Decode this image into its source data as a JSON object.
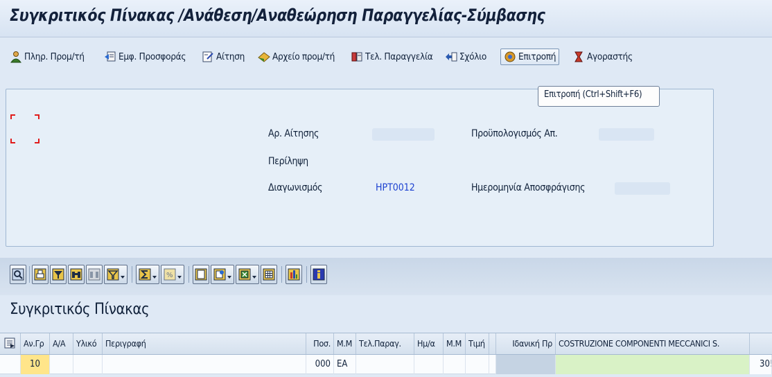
{
  "window": {
    "title": "Συγκριτικός Πίνακας /Ανάθεση/Αναθεώρηση Παραγγελίας-Σύμβασης"
  },
  "toolbar": {
    "items": [
      {
        "label": "Πληρ. Προμ/τή",
        "icon": "person-info-icon"
      },
      {
        "label": "Εμφ. Προσφοράς",
        "icon": "offer-display-icon"
      },
      {
        "label": "Αίτηση",
        "icon": "request-document-icon"
      },
      {
        "label": "Αρχείο προμ/τή",
        "icon": "vendor-file-icon"
      },
      {
        "label": "Τελ. Παραγγελία",
        "icon": "final-order-icon"
      },
      {
        "label": "Σχόλιο",
        "icon": "comment-icon"
      },
      {
        "label": "Επιτροπή",
        "icon": "committee-icon"
      },
      {
        "label": "Αγοραστής",
        "icon": "buyer-icon"
      }
    ]
  },
  "tooltip": {
    "text": "Επιτροπή   (Ctrl+Shift+F6)"
  },
  "header": {
    "request_no_label": "Αρ. Αίτησης",
    "summary_label": "Περίληψη",
    "tender_label": "Διαγωνισμός",
    "tender_value": "HPT0012",
    "budget_label": "Προϋπολογισμός Απ.",
    "unseal_date_label": "Ημερομηνία Αποσφράγισης"
  },
  "grid_toolbar": {
    "buttons": [
      "details-icon",
      "print-icon",
      "filter-icon",
      "find-icon",
      "find-next-icon",
      "set-filter-icon",
      "sum-icon",
      "subtotal-icon",
      "print-preview-icon",
      "export-icon",
      "spreadsheet-icon",
      "grid-layout-icon",
      "chart-icon",
      "info-icon"
    ]
  },
  "grid": {
    "title": "Συγκριτικός Πίνακας",
    "columns": [
      "Αν.Γρ",
      "Α/Α",
      "Υλικό",
      "Περιγραφή",
      "Ποσ.",
      "Μ.Μ",
      "Τελ.Παραγ.",
      "Ημ/α",
      "Μ.Μ",
      "Τιμή",
      "Ιδανική Πρ",
      "COSTRUZIONE COMPONENTI MECCANICI S."
    ],
    "rows": [
      {
        "av_gr": "10",
        "aa": "",
        "material": "",
        "description": "",
        "qty": "000",
        "uom": "EA",
        "final_order": "",
        "date": "",
        "uom2": "",
        "price": "",
        "ideal": "",
        "vendor": "",
        "overflow": "30!"
      }
    ]
  },
  "colors": {
    "background": "#dfe9f5",
    "tender_value": "#1a3fd0",
    "focus_corner": "#e01b1b",
    "highlight_cell": "#ffe58a",
    "vendor_cell": "#d9f2c6"
  }
}
